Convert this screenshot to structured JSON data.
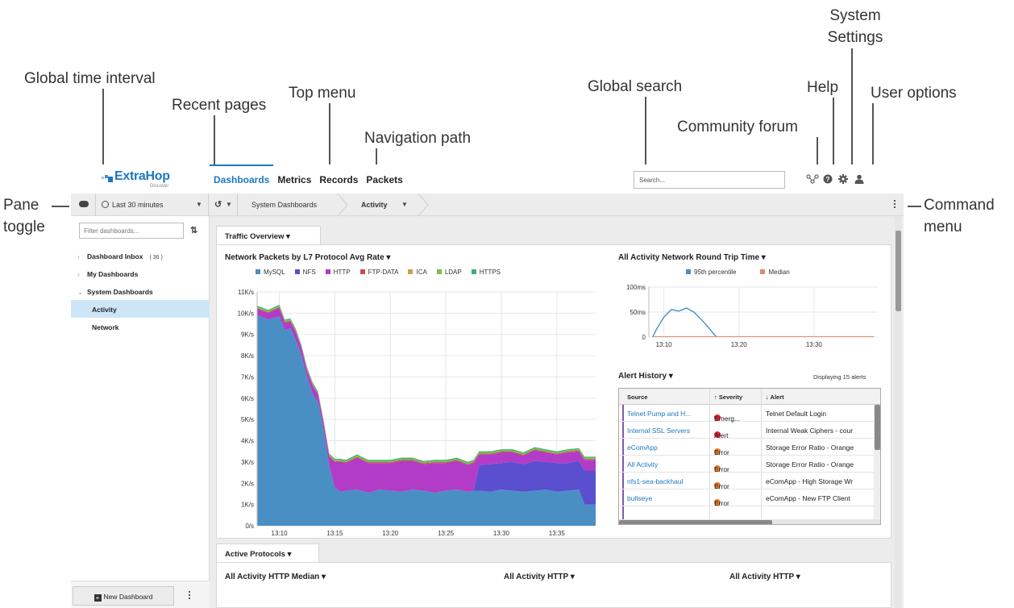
{
  "annotations": {
    "global_time_interval": "Global time interval",
    "recent_pages": "Recent pages",
    "top_menu": "Top menu",
    "navigation_path": "Navigation path",
    "global_search": "Global search",
    "community_forum": "Community forum",
    "help": "Help",
    "system_settings_line1": "System",
    "system_settings_line2": "Settings",
    "user_options": "User options",
    "pane_label": "Pane",
    "toggle_label": "toggle",
    "command_label": "Command",
    "menu_label": "menu"
  },
  "app": {
    "logo_name": "ExtraHop",
    "logo_sub": "Discover",
    "top_menu": [
      "Dashboards",
      "Metrics",
      "Records",
      "Packets"
    ],
    "search_placeholder": "Search...",
    "time_interval": "Last 30 minutes",
    "breadcrumb": [
      "System Dashboards",
      "Activity"
    ],
    "filter_placeholder": "Filter dashboards...",
    "sidebar": {
      "dashboard_inbox": "Dashboard Inbox",
      "dashboard_inbox_count": "( 36 )",
      "my_dashboards": "My Dashboards",
      "system_dashboards": "System Dashboards",
      "children": [
        "Activity",
        "Network"
      ]
    },
    "new_dashboard": "New Dashboard"
  },
  "traffic_overview": {
    "tab": "Traffic Overview ▾",
    "packets_title": "Network Packets by L7 Protocol Avg Rate ▾",
    "legend": [
      {
        "name": "MySQL",
        "color": "#4a8fc4"
      },
      {
        "name": "NFS",
        "color": "#5a4fcf"
      },
      {
        "name": "HTTP",
        "color": "#b23cc8"
      },
      {
        "name": "FTP-DATA",
        "color": "#d14a4a"
      },
      {
        "name": "ICA",
        "color": "#c9a04b"
      },
      {
        "name": "LDAP",
        "color": "#7bbf4a"
      },
      {
        "name": "HTTPS",
        "color": "#3fae6f"
      }
    ],
    "rtt_title": "All Activity Network Round Trip Time ▾",
    "rtt_legend": [
      {
        "name": "95th percentile",
        "color": "#4a8fc4"
      },
      {
        "name": "Median",
        "color": "#d98c6a"
      }
    ],
    "alert_history_title": "Alert History ▾",
    "alert_count": "Displaying 15 alerts",
    "alert_headers": [
      "Source",
      "↑ Severity",
      "↓ Alert"
    ],
    "alerts": [
      {
        "source": "Telnet Pump and H...",
        "severity": "Emerg...",
        "color": "#e8202a",
        "alert": "Telnet Default Login"
      },
      {
        "source": "Internal SSL Servers",
        "severity": "Alert",
        "color": "#e8202a",
        "alert": "Internal Weak Ciphers - cour"
      },
      {
        "source": "eComApp",
        "severity": "Error",
        "color": "#f07a22",
        "alert": "Storage Error Ratio - Orange"
      },
      {
        "source": "All Activity",
        "severity": "Error",
        "color": "#f07a22",
        "alert": "Storage Error Ratio - Orange"
      },
      {
        "source": "nfs1-sea-backhaul",
        "severity": "Error",
        "color": "#f07a22",
        "alert": "eComApp - High Storage Wr"
      },
      {
        "source": "bullseye",
        "severity": "Error",
        "color": "#f07a22",
        "alert": "eComApp - New FTP Client"
      }
    ]
  },
  "active_protocols": {
    "tab": "Active Protocols ▾",
    "titles": [
      "All Activity HTTP Median ▾",
      "All Activity HTTP ▾",
      "All Activity HTTP ▾"
    ]
  },
  "chart_data": [
    {
      "type": "area",
      "title": "Network Packets by L7 Protocol Avg Rate",
      "x_tick_labels": [
        "13:10",
        "13:15",
        "13:20",
        "13:25",
        "13:30",
        "13:35"
      ],
      "y_tick_labels": [
        "0/s",
        "1K/s",
        "2K/s",
        "3K/s",
        "4K/s",
        "5K/s",
        "6K/s",
        "7K/s",
        "8K/s",
        "9K/s",
        "10K/s",
        "11K/s"
      ],
      "ylim": [
        0,
        11000
      ],
      "xlim_min": [
        8,
        38.5
      ],
      "stacked": true,
      "x": [
        8,
        9,
        10,
        10.5,
        11,
        11.5,
        12,
        12.5,
        13,
        13.5,
        14,
        14.5,
        15,
        15.5,
        16,
        17,
        18,
        19,
        20,
        21,
        22,
        23,
        24,
        25,
        26,
        27,
        27.5,
        28,
        29,
        30,
        31,
        32,
        33,
        34,
        35,
        36,
        37,
        37.5,
        38,
        38.5
      ],
      "series": [
        {
          "name": "MySQL",
          "values": [
            9900,
            9700,
            9850,
            9200,
            9300,
            8700,
            8000,
            7000,
            6200,
            5800,
            4500,
            2800,
            1800,
            1600,
            1650,
            1700,
            1550,
            1700,
            1650,
            1600,
            1700,
            1650,
            1550,
            1650,
            1700,
            1600,
            1650,
            1650,
            1600,
            1700,
            1650,
            1600,
            1650,
            1700,
            1600,
            1650,
            1700,
            1000,
            1000,
            1000
          ]
        },
        {
          "name": "NFS",
          "values": [
            0,
            0,
            0,
            0,
            0,
            0,
            0,
            0,
            0,
            0,
            0,
            0,
            0,
            0,
            0,
            0,
            0,
            0,
            0,
            0,
            0,
            0,
            0,
            0,
            0,
            0,
            0,
            1200,
            1300,
            1250,
            1350,
            1300,
            1400,
            1300,
            1350,
            1300,
            1350,
            1600,
            1600,
            1600
          ]
        },
        {
          "name": "HTTP",
          "values": [
            300,
            300,
            400,
            350,
            300,
            400,
            350,
            300,
            400,
            350,
            300,
            450,
            1200,
            1400,
            1300,
            1500,
            1400,
            1250,
            1300,
            1450,
            1350,
            1250,
            1400,
            1300,
            1350,
            1250,
            1300,
            500,
            450,
            500,
            450,
            400,
            500,
            450,
            400,
            500,
            450,
            500,
            500,
            500
          ]
        },
        {
          "name": "FTP-DATA",
          "values": [
            40,
            40,
            40,
            40,
            40,
            40,
            40,
            40,
            40,
            40,
            40,
            40,
            40,
            40,
            40,
            40,
            40,
            40,
            40,
            40,
            40,
            40,
            40,
            40,
            40,
            40,
            40,
            40,
            40,
            40,
            40,
            40,
            40,
            40,
            40,
            40,
            40,
            40,
            40,
            40
          ]
        },
        {
          "name": "LDAP",
          "values": [
            60,
            60,
            60,
            60,
            60,
            60,
            60,
            60,
            60,
            60,
            60,
            60,
            60,
            60,
            60,
            60,
            60,
            60,
            60,
            60,
            60,
            60,
            60,
            60,
            60,
            60,
            60,
            60,
            60,
            60,
            60,
            60,
            60,
            60,
            60,
            60,
            60,
            60,
            60,
            60
          ]
        },
        {
          "name": "HTTPS",
          "values": [
            50,
            50,
            50,
            50,
            50,
            50,
            50,
            50,
            50,
            50,
            50,
            50,
            50,
            50,
            50,
            50,
            50,
            50,
            50,
            50,
            50,
            50,
            50,
            50,
            50,
            50,
            50,
            50,
            50,
            50,
            50,
            50,
            50,
            50,
            50,
            50,
            50,
            50,
            50,
            50
          ]
        }
      ]
    },
    {
      "type": "line",
      "title": "All Activity Network Round Trip Time",
      "x_tick_labels": [
        "13:10",
        "13:20",
        "13:30"
      ],
      "y_tick_labels": [
        "0",
        "50ms",
        "100ms"
      ],
      "ylim": [
        0,
        100
      ],
      "xlim_min": [
        8,
        38.5
      ],
      "series": [
        {
          "name": "95th percentile",
          "x": [
            8.5,
            9,
            10,
            11,
            12,
            13,
            14,
            15,
            16,
            17
          ],
          "values": [
            0,
            15,
            40,
            55,
            52,
            58,
            50,
            35,
            18,
            0
          ]
        },
        {
          "name": "Median",
          "x": [
            8.5,
            17,
            38
          ],
          "values": [
            1,
            1,
            1
          ]
        }
      ]
    }
  ]
}
